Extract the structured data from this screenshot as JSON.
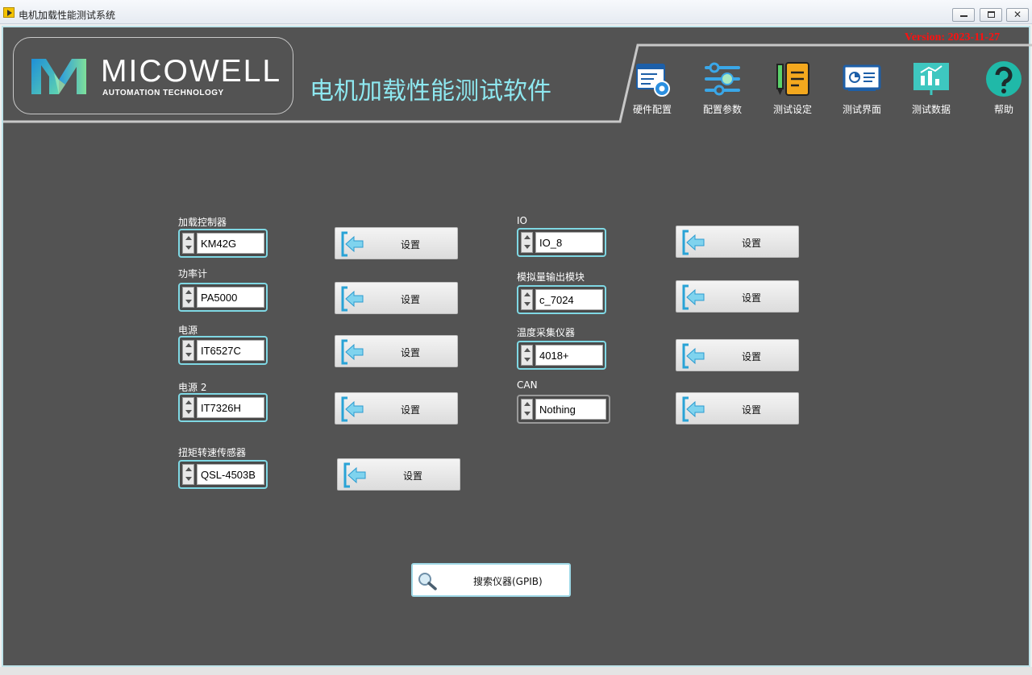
{
  "window": {
    "title": "电机加载性能测试系统"
  },
  "header": {
    "version": "Version: 2023-11-27",
    "brand_name": "MICOWELL",
    "brand_sub": "AUTOMATION TECHNOLOGY",
    "app_title": "电机加载性能测试软件"
  },
  "nav": [
    {
      "label": "硬件配置",
      "icon": "hardware-config-icon"
    },
    {
      "label": "配置参数",
      "icon": "sliders-icon"
    },
    {
      "label": "测试设定",
      "icon": "notepad-icon"
    },
    {
      "label": "测试界面",
      "icon": "monitor-chart-icon"
    },
    {
      "label": "测试数据",
      "icon": "data-board-icon"
    },
    {
      "label": "帮助",
      "icon": "help-icon"
    }
  ],
  "devices": [
    {
      "label": "加载控制器",
      "value": "KM42G",
      "button": "设置"
    },
    {
      "label": "功率计",
      "value": "PA5000",
      "button": "设置"
    },
    {
      "label": "电源",
      "value": "IT6527C",
      "button": "设置"
    },
    {
      "label": "电源 2",
      "value": "IT7326H",
      "button": "设置"
    },
    {
      "label": "扭矩转速传感器",
      "value": "QSL-4503B",
      "button": "设置"
    },
    {
      "label": "IO",
      "value": "IO_8",
      "button": "设置"
    },
    {
      "label": "模拟量输出模块",
      "value": "c_7024",
      "button": "设置"
    },
    {
      "label": "温度采集仪器",
      "value": "4018+",
      "button": "设置"
    },
    {
      "label": "CAN",
      "value": "Nothing",
      "button": "设置"
    }
  ],
  "search_button": "搜索仪器(GPIB)",
  "colors": {
    "background": "#535353",
    "accent": "#8ee8f0",
    "version": "#ff1010"
  }
}
